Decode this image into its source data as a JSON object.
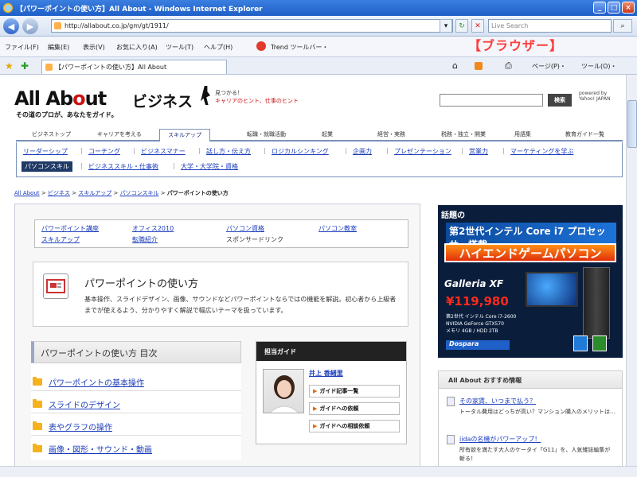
{
  "window": {
    "title": "【パワーポイントの使い方】All About - Windows Internet Explorer",
    "minimize": "_",
    "maximize": "□",
    "close": "×"
  },
  "address_bar": {
    "url": "http://allabout.co.jp/gm/gt/1911/",
    "search_placeholder": "Live Search"
  },
  "menu": {
    "items": [
      "ファイル(F)",
      "編集(E)",
      "表示(V)",
      "お気に入り(A)",
      "ツール(T)",
      "ヘルプ(H)"
    ],
    "trend": "Trend ツールバー・"
  },
  "annotation": "【ブラウザー】",
  "tab": {
    "label": "【パワーポイントの使い方】All About",
    "page_tool": "ページ(P)・",
    "tools_tool": "ツール(O)・"
  },
  "site": {
    "logo_part1": "All Ab",
    "logo_o": "o",
    "logo_part2": "ut",
    "logo_biz": "ビジネス",
    "tagline_l1": "見つかる！",
    "tagline_l2": "キャリアのヒント、仕事のヒント",
    "subtitle": "その道のプロが、あなたをガイド。",
    "search_button": "検索",
    "powered_l1": "powered by",
    "powered_l2": "Yahoo! JAPAN"
  },
  "nav_tabs": [
    "ビジネストップ",
    "キャリアを考える",
    "スキルアップ",
    "転職・就職活動",
    "起業",
    "経営・実務",
    "税務・独立・開業",
    "用語集",
    "教育ガイド一覧"
  ],
  "sub_nav": {
    "row1": [
      "リーダーシップ",
      "コーチング",
      "ビジネスマナー",
      "話し方・伝え方",
      "ロジカルシンキング",
      "企画力",
      "プレゼンテーション",
      "営業力",
      "マーケティングを学ぶ"
    ],
    "row2_active": "パソコンスキル",
    "row2": [
      "ビジネススキル・仕事術",
      "大学・大学院・資格"
    ]
  },
  "breadcrumb": {
    "items": [
      "All About",
      "ビジネス",
      "スキルアップ",
      "パソコンスキル"
    ],
    "current": "パワーポイントの使い方"
  },
  "link_box": {
    "links": [
      "パワーポイント講座",
      "オフィス2010",
      "パソコン資格",
      "パソコン教室",
      "スキルアップ",
      "転職紹介"
    ],
    "sponsor": "スポンサードリンク"
  },
  "intro": {
    "title": "パワーポイントの使い方",
    "description": "基本操作、スライドデザイン、画像、サウンドなどパワーポイントならではの機能を解説。初心者から上級者までが使えるよう、分かりやすく解説で幅広いテーマを扱っています。"
  },
  "toc": {
    "heading": "パワーポイントの使い方 目次",
    "items": [
      "パワーポイントの基本操作",
      "スライドのデザイン",
      "表やグラフの操作",
      "画像・図形・サウンド・動画"
    ]
  },
  "guide": {
    "heading": "担当ガイド",
    "name": "井上 香緒里",
    "buttons": [
      "ガイド記事一覧",
      "ガイドへの依頼",
      "ガイドへの相談依頼"
    ]
  },
  "ad": {
    "line1": "話題の",
    "line2": "第2世代インテル Core i7 プロセッサー搭載",
    "line3": "ハイエンドゲームパソコン",
    "model": "Galleria XF",
    "price": "¥119,980",
    "spec_l1": "第2世代 インテル Core i7-2600",
    "spec_l2": "NVIDIA GeForce GTX570",
    "spec_l3": "メモリ 4GB / HDD 2TB",
    "logo": "Dospara"
  },
  "recommend": {
    "heading": "All About おすすめ情報",
    "items": [
      {
        "title": "その家賃、いつまで払う？",
        "desc": "トータル費用はどっちが高い？マンション購入のメリットは…"
      },
      {
        "title": "iidaの名機がパワーアップ！",
        "desc": "所有欲を満たす大人のケータイ「G11」を、人気雑誌編集が斬る！"
      }
    ]
  },
  "colors": {
    "ie_title": "#1f5fc8",
    "annotation": "#ff3b3b",
    "link": "#1a3cbb",
    "ad_bg": "#0a1e3c",
    "ad_price": "#ff2a1a"
  }
}
